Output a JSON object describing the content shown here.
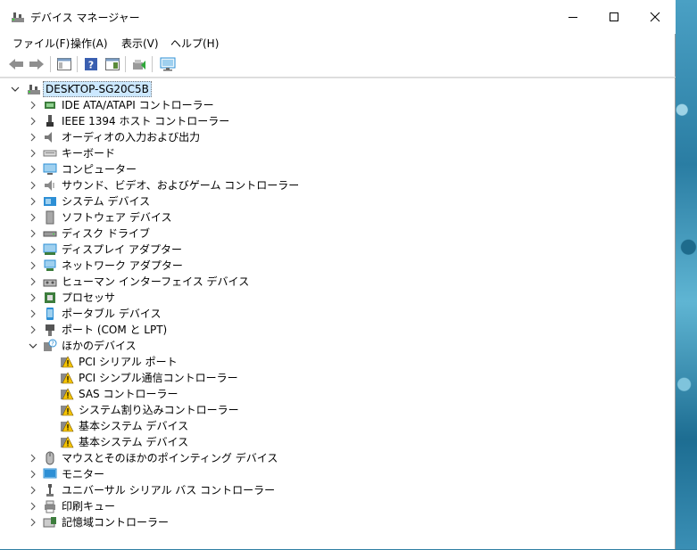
{
  "window": {
    "title": "デバイス マネージャー",
    "controls": [
      "minimize-icon",
      "maximize-icon",
      "close-icon"
    ]
  },
  "menubar": {
    "items": [
      "ファイル(F)",
      "操作(A)",
      "表示(V)",
      "ヘルプ(H)"
    ]
  },
  "toolbar": {
    "buttons": [
      "back-arrow-icon",
      "forward-arrow-icon",
      "properties-view-icon",
      "help-icon",
      "details-pane-icon",
      "update-driver-icon",
      "monitor-scan-icon"
    ]
  },
  "tree": {
    "root": "DESKTOP-SG20C5B",
    "categories": [
      {
        "label": "IDE ATA/ATAPI コントローラー",
        "icon": "ide-controller-icon",
        "expanded": false
      },
      {
        "label": "IEEE 1394 ホスト コントローラー",
        "icon": "ieee1394-icon",
        "expanded": false
      },
      {
        "label": "オーディオの入力および出力",
        "icon": "speaker-icon",
        "expanded": false
      },
      {
        "label": "キーボード",
        "icon": "keyboard-icon",
        "expanded": false
      },
      {
        "label": "コンピューター",
        "icon": "computer-icon",
        "expanded": false
      },
      {
        "label": "サウンド、ビデオ、およびゲーム コントローラー",
        "icon": "sound-icon",
        "expanded": false
      },
      {
        "label": "システム デバイス",
        "icon": "system-device-icon",
        "expanded": false
      },
      {
        "label": "ソフトウェア デバイス",
        "icon": "software-device-icon",
        "expanded": false
      },
      {
        "label": "ディスク ドライブ",
        "icon": "disk-drive-icon",
        "expanded": false
      },
      {
        "label": "ディスプレイ アダプター",
        "icon": "display-adapter-icon",
        "expanded": false
      },
      {
        "label": "ネットワーク アダプター",
        "icon": "network-adapter-icon",
        "expanded": false
      },
      {
        "label": "ヒューマン インターフェイス デバイス",
        "icon": "hid-icon",
        "expanded": false
      },
      {
        "label": "プロセッサ",
        "icon": "processor-icon",
        "expanded": false
      },
      {
        "label": "ポータブル デバイス",
        "icon": "portable-device-icon",
        "expanded": false
      },
      {
        "label": "ポート (COM と LPT)",
        "icon": "port-icon",
        "expanded": false
      },
      {
        "label": "ほかのデバイス",
        "icon": "unknown-device-icon",
        "expanded": true,
        "children": [
          "PCI シリアル ポート",
          "PCI シンプル通信コントローラー",
          "SAS コントローラー",
          "システム割り込みコントローラー",
          "基本システム デバイス",
          "基本システム デバイス"
        ]
      },
      {
        "label": "マウスとそのほかのポインティング デバイス",
        "icon": "mouse-icon",
        "expanded": false
      },
      {
        "label": "モニター",
        "icon": "monitor-icon",
        "expanded": false
      },
      {
        "label": "ユニバーサル シリアル バス コントローラー",
        "icon": "usb-icon",
        "expanded": false
      },
      {
        "label": "印刷キュー",
        "icon": "printer-icon",
        "expanded": false
      },
      {
        "label": "記憶域コントローラー",
        "icon": "storage-controller-icon",
        "expanded": false
      }
    ]
  },
  "colors": {
    "selection": "#cce8ff",
    "warning": "#f5c400",
    "monitor_blue": "#2d8fd5"
  }
}
